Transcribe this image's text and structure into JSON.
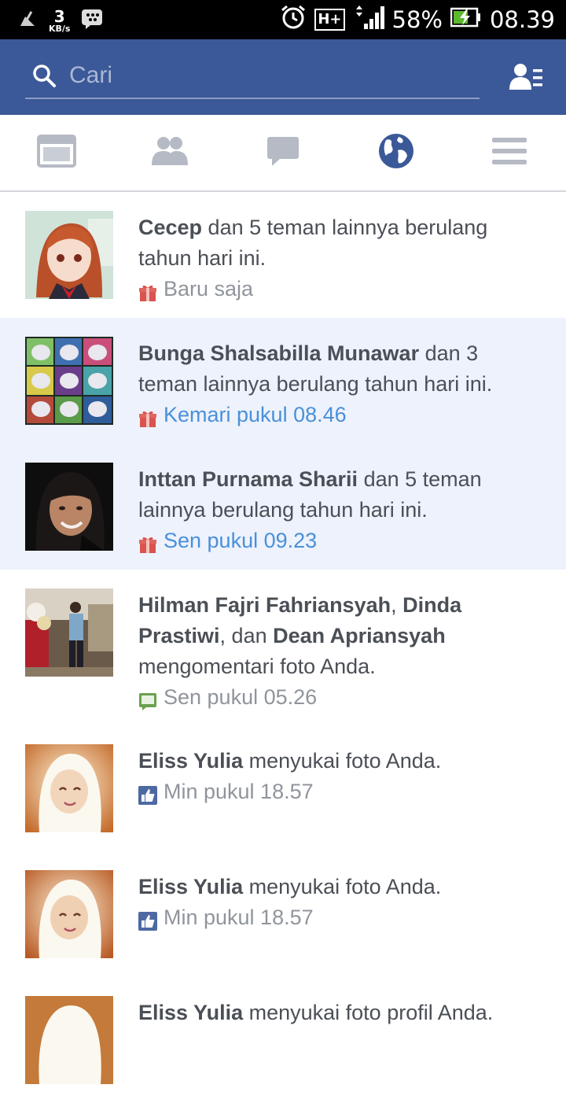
{
  "status_bar": {
    "speed_value": "3",
    "speed_unit": "KB/s",
    "network": "H+",
    "battery_percent": "58%",
    "time": "08.39"
  },
  "search": {
    "placeholder": "Cari"
  },
  "tabs": [
    {
      "name": "news-feed",
      "icon": "news-feed-icon",
      "active": false
    },
    {
      "name": "friend-requests",
      "icon": "friends-icon",
      "active": false
    },
    {
      "name": "messages",
      "icon": "chat-bubble-icon",
      "active": false
    },
    {
      "name": "notifications",
      "icon": "globe-icon",
      "active": true
    },
    {
      "name": "more",
      "icon": "menu-icon",
      "active": false
    }
  ],
  "colors": {
    "brand": "#3b5998",
    "unread_bg": "#edf2fc",
    "link_time": "#4a90d9"
  },
  "notifications": [
    {
      "name_1": "Cecep",
      "text_1": " dan 5 teman lainnya berulang tahun hari ini.",
      "time": "Baru saja",
      "icon": "gift-icon",
      "unread": false
    },
    {
      "name_1": "Bunga Shalsabilla Munawar",
      "text_1": " dan 3 teman lainnya berulang tahun hari ini.",
      "time": "Kemari pukul 08.46",
      "icon": "gift-icon",
      "unread": true
    },
    {
      "name_1": "Inttan Purnama Sharii",
      "text_1": " dan 5 teman lainnya berulang tahun hari ini.",
      "time": "Sen pukul 09.23",
      "icon": "gift-icon",
      "unread": true
    },
    {
      "name_1": "Hilman Fajri Fahriansyah",
      "sep_1": ", ",
      "name_2": "Dinda Prastiwi",
      "sep_2": ", dan ",
      "name_3": "Dean Apriansyah",
      "text_1": " mengomentari foto Anda.",
      "time": "Sen pukul 05.26",
      "icon": "comment-icon",
      "unread": false
    },
    {
      "name_1": "Eliss Yulia",
      "text_1": " menyukai foto Anda.",
      "time": "Min pukul 18.57",
      "icon": "like-icon",
      "unread": false
    },
    {
      "name_1": "Eliss Yulia",
      "text_1": " menyukai foto Anda.",
      "time": "Min pukul 18.57",
      "icon": "like-icon",
      "unread": false
    },
    {
      "name_1": "Eliss Yulia",
      "text_1": " menyukai foto profil Anda.",
      "time": "",
      "icon": "like-icon",
      "unread": false
    }
  ]
}
